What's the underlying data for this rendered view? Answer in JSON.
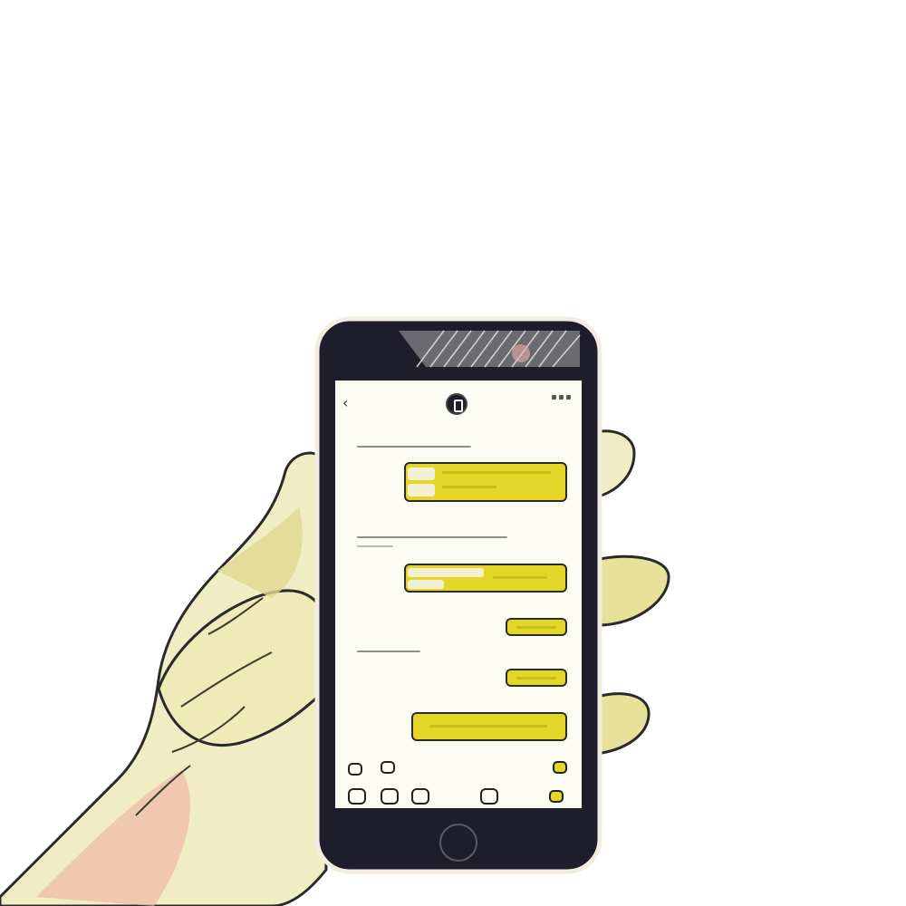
{
  "scene": {
    "description_visible_text": "",
    "colors": {
      "background": "#ffffff",
      "skin": "#f0ecc4",
      "skin_shadow": "#e0d890",
      "skin_warm": "#f0b8a8",
      "phone_body": "#1e1d2b",
      "screen": "#fbfbf4",
      "bubble_fill": "#e3d628",
      "outline": "#2a2a2a"
    }
  },
  "phone": {
    "screen": {
      "topbar": {
        "back_icon": "chevron-left-icon",
        "avatar_icon": "contact-avatar-icon"
      },
      "messages": [
        {
          "kind": "incoming-line"
        },
        {
          "kind": "outgoing-bubble"
        },
        {
          "kind": "incoming-line"
        },
        {
          "kind": "outgoing-bubble"
        },
        {
          "kind": "outgoing-bubble"
        },
        {
          "kind": "incoming-line"
        },
        {
          "kind": "outgoing-bubble"
        },
        {
          "kind": "outgoing-bubble"
        }
      ],
      "bottom_icons": [
        "camera-icon",
        "appstore-icon",
        "sticker-icon",
        "emoji-icon",
        "music-icon",
        "photos-icon",
        "mic-icon",
        "send-icon"
      ]
    },
    "home_button_icon": "home-button-icon"
  }
}
